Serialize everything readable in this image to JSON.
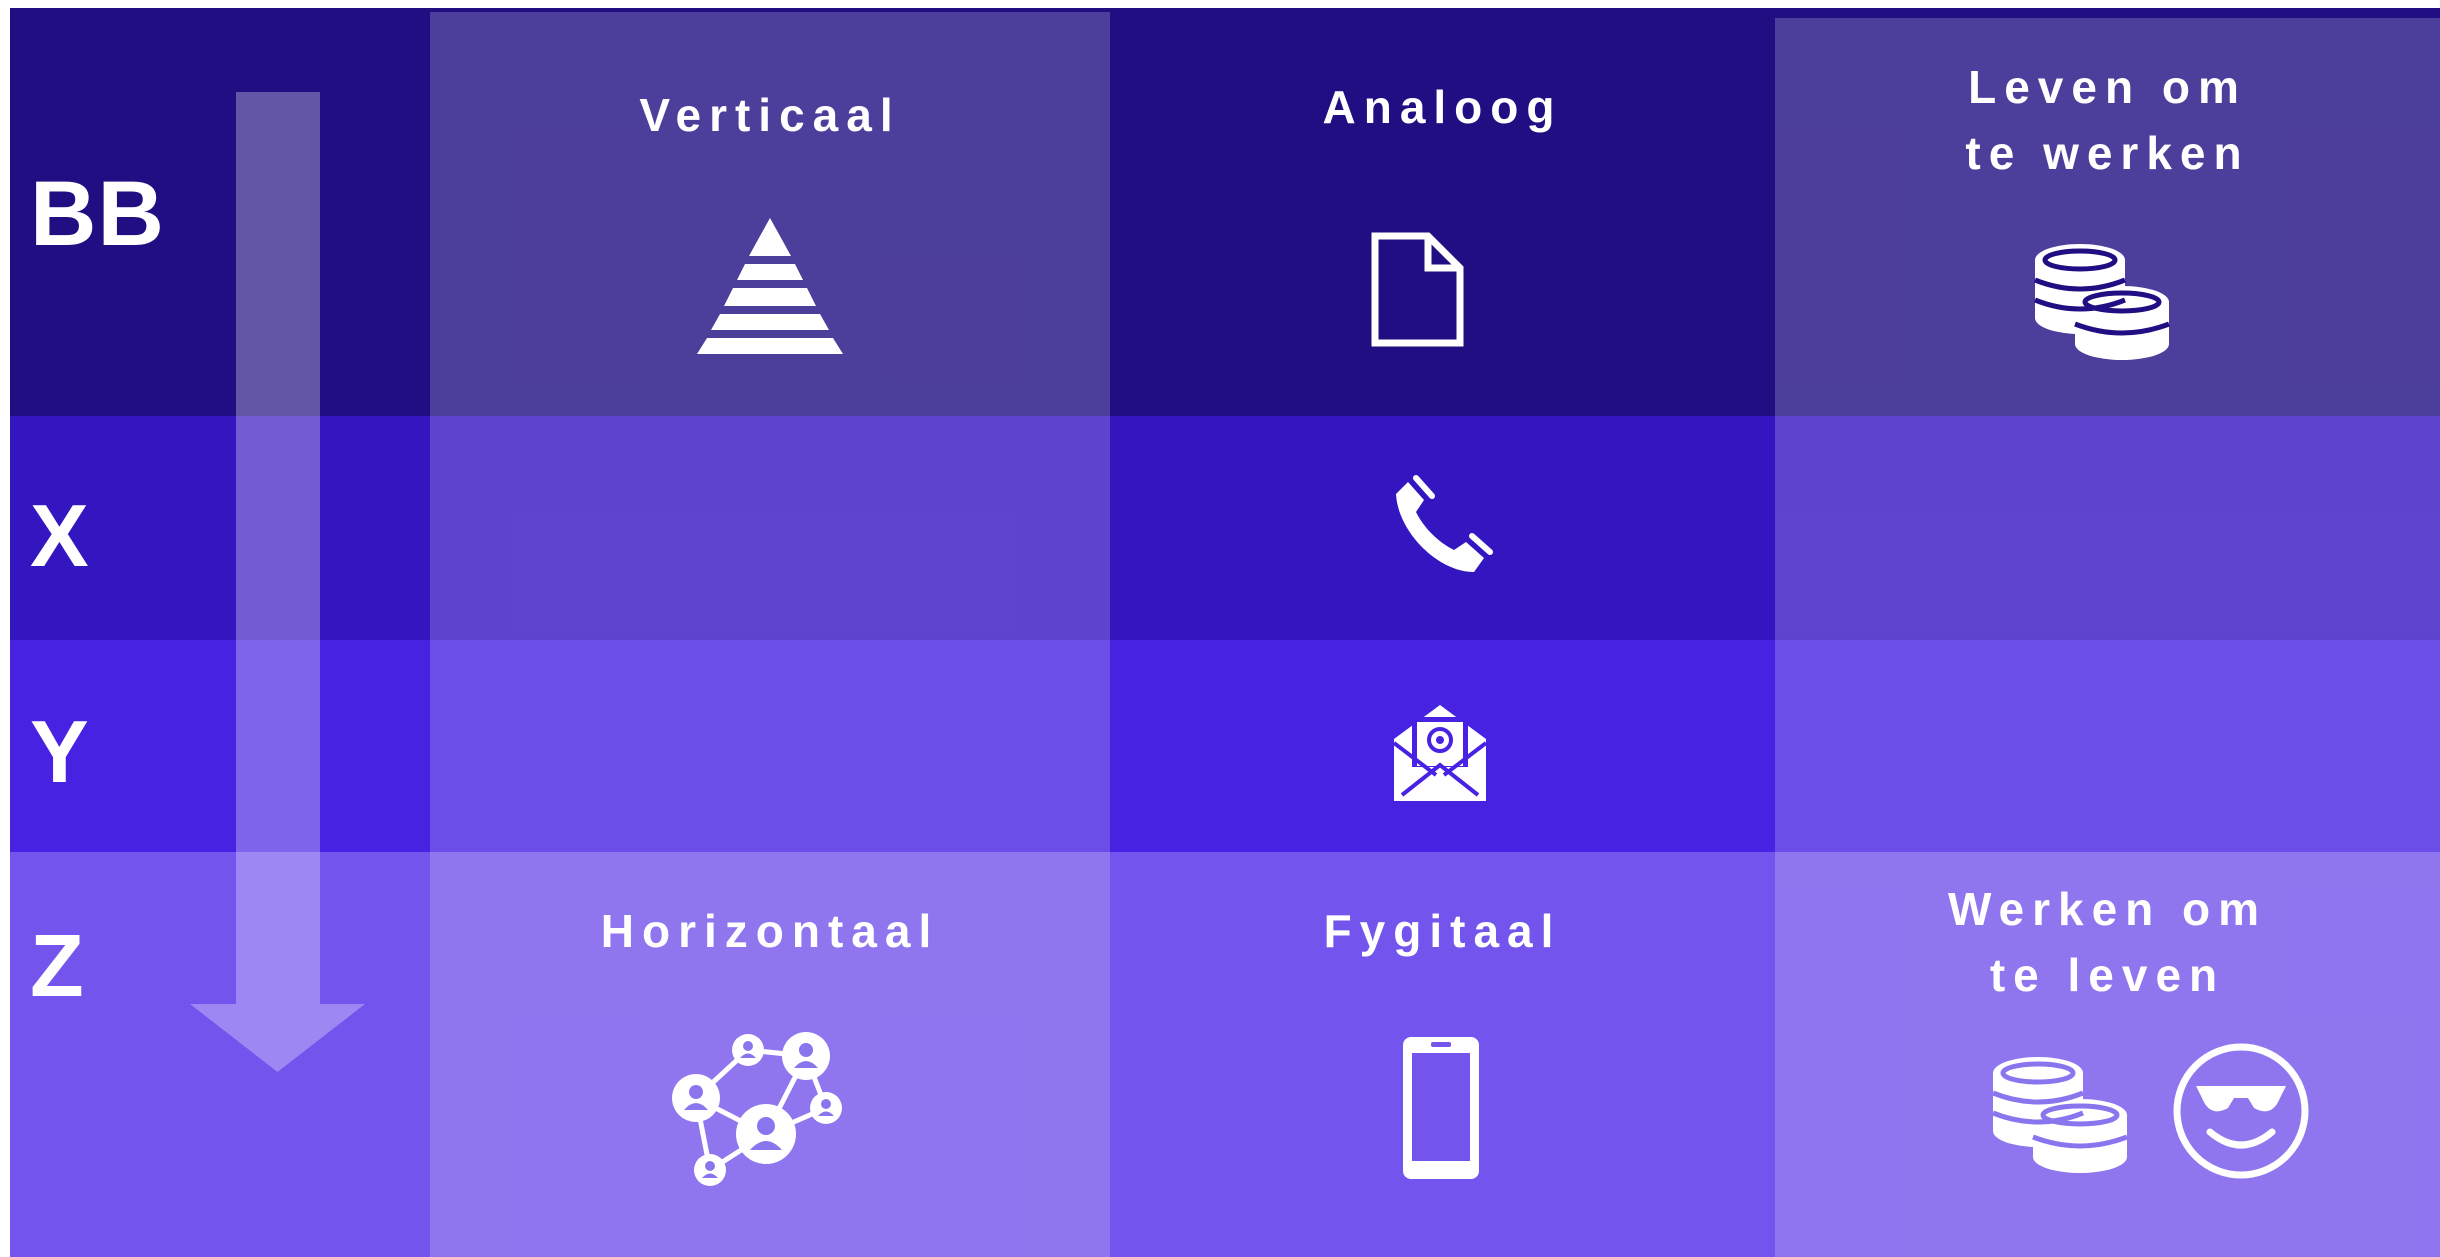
{
  "rows": [
    {
      "label": "BB"
    },
    {
      "label": "X"
    },
    {
      "label": "Y"
    },
    {
      "label": "Z"
    }
  ],
  "columns": {
    "top": [
      {
        "title": "Verticaal",
        "icon": "pyramid-icon"
      },
      {
        "title": "Analoog",
        "icon": "document-icon"
      },
      {
        "title_line1": "Leven om",
        "title_line2": "te werken",
        "icon": "coins-icon"
      }
    ],
    "bottom": [
      {
        "title": "Horizontaal",
        "icon": "network-icon"
      },
      {
        "title": "Fygitaal",
        "icon": "smartphone-icon"
      },
      {
        "title_line1": "Werken om",
        "title_line2": "te leven",
        "icons": [
          "coins-icon",
          "sunglasses-smiley-icon"
        ]
      }
    ]
  },
  "middle_icons": {
    "x": "telephone-icon",
    "y": "email-envelope-icon"
  },
  "colors": {
    "band_bb": "#200e82",
    "band_x": "#3416c0",
    "band_y": "#4722e3",
    "band_z": "#7354ec",
    "icon": "#ffffff"
  }
}
